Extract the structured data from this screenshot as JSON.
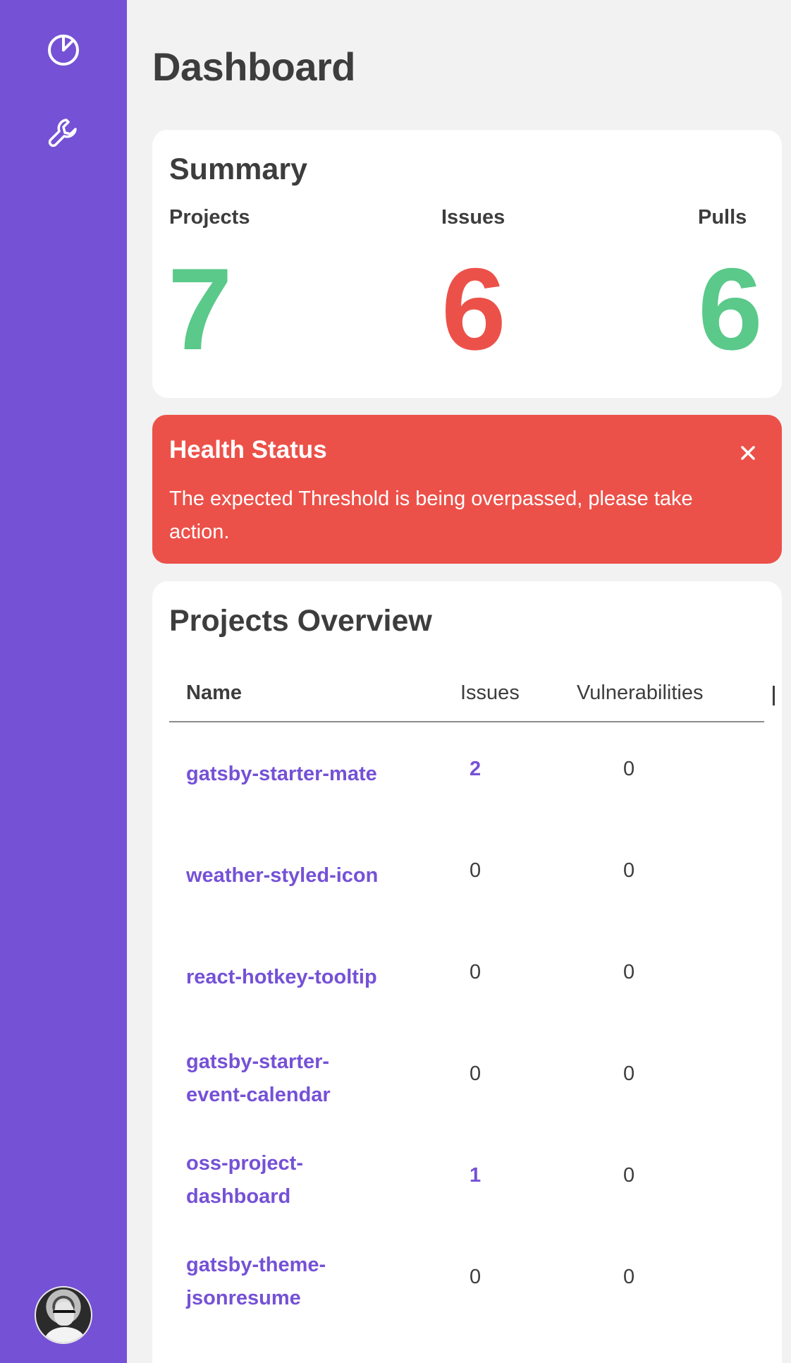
{
  "sidebar": {
    "nav": [
      {
        "icon": "pie-chart-icon"
      },
      {
        "icon": "wrench-icon"
      }
    ],
    "avatar": "user-avatar"
  },
  "page": {
    "title": "Dashboard"
  },
  "summary": {
    "title": "Summary",
    "stats": [
      {
        "label": "Projects",
        "value": "7",
        "color": "#5ac98a"
      },
      {
        "label": "Issues",
        "value": "6",
        "color": "#ec5149"
      },
      {
        "label": "Pulls",
        "value": "6",
        "color": "#5ac98a"
      }
    ]
  },
  "alert": {
    "title": "Health Status",
    "message": "The expected Threshold is being overpassed, please take action.",
    "close_icon": "close-icon",
    "color": "#ec5149"
  },
  "projects": {
    "title": "Projects Overview",
    "columns": [
      "Name",
      "Issues",
      "Vulnerabilities"
    ],
    "rows": [
      {
        "name": "gatsby-starter-mate",
        "issues": "2",
        "vulnerabilities": "0"
      },
      {
        "name": "weather-styled-icon",
        "issues": "0",
        "vulnerabilities": "0"
      },
      {
        "name": "react-hotkey-tooltip",
        "issues": "0",
        "vulnerabilities": "0"
      },
      {
        "name": "gatsby-starter-event-calendar",
        "issues": "0",
        "vulnerabilities": "0"
      },
      {
        "name": "oss-project-dashboard",
        "issues": "1",
        "vulnerabilities": "0"
      },
      {
        "name": "gatsby-theme-jsonresume",
        "issues": "0",
        "vulnerabilities": "0"
      }
    ]
  },
  "theme": {
    "accent": "#7551d6",
    "success": "#5ac98a",
    "danger": "#ec5149"
  }
}
